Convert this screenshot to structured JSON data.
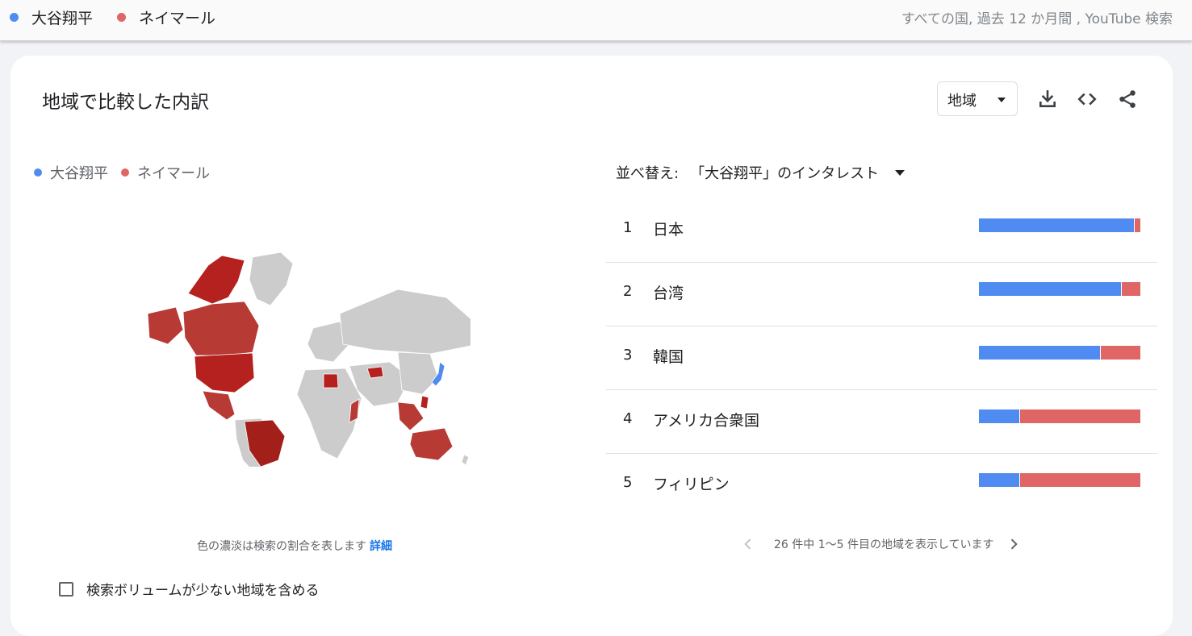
{
  "header": {
    "legend": [
      {
        "label": "大谷翔平",
        "color": "#4f8bf0"
      },
      {
        "label": "ネイマール",
        "color": "#e06666"
      }
    ],
    "filter_summary": "すべての国, 過去 12 か月間 , YouTube 検索"
  },
  "card": {
    "title": "地域で比較した内訳",
    "region_select": {
      "value": "地域"
    },
    "icons": [
      "download-icon",
      "embed-code-icon",
      "share-icon"
    ],
    "map_legend": [
      {
        "label": "大谷翔平",
        "color": "#4f8bf0"
      },
      {
        "label": "ネイマール",
        "color": "#e06666"
      }
    ],
    "sort": {
      "label": "並べ替え:",
      "value": "「大谷翔平」のインタレスト"
    },
    "rows": [
      {
        "rank": "1",
        "name": "日本",
        "share_a": 96
      },
      {
        "rank": "2",
        "name": "台湾",
        "share_a": 88
      },
      {
        "rank": "3",
        "name": "韓国",
        "share_a": 75
      },
      {
        "rank": "4",
        "name": "アメリカ合衆国",
        "share_a": 25
      },
      {
        "rank": "5",
        "name": "フィリピン",
        "share_a": 25
      }
    ],
    "map_caption": {
      "text": "色の濃淡は検索の割合を表します",
      "link": "詳細"
    },
    "pager": {
      "text": "26 件中 1～5 件目の地域を表示しています"
    },
    "low_volume_checkbox": {
      "label": "検索ボリュームが少ない地域を含める",
      "checked": false
    }
  }
}
